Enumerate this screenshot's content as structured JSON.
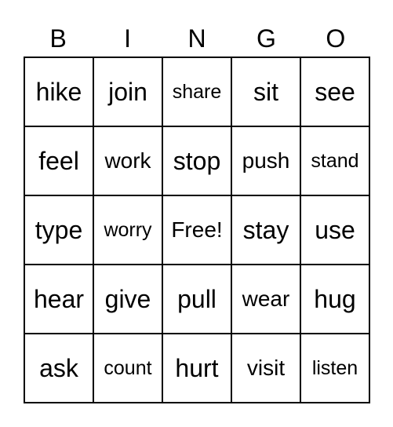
{
  "header": [
    "B",
    "I",
    "N",
    "G",
    "O"
  ],
  "rows": [
    [
      "hike",
      "join",
      "share",
      "sit",
      "see"
    ],
    [
      "feel",
      "work",
      "stop",
      "push",
      "stand"
    ],
    [
      "type",
      "worry",
      "Free!",
      "stay",
      "use"
    ],
    [
      "hear",
      "give",
      "pull",
      "wear",
      "hug"
    ],
    [
      "ask",
      "count",
      "hurt",
      "visit",
      "listen"
    ]
  ]
}
